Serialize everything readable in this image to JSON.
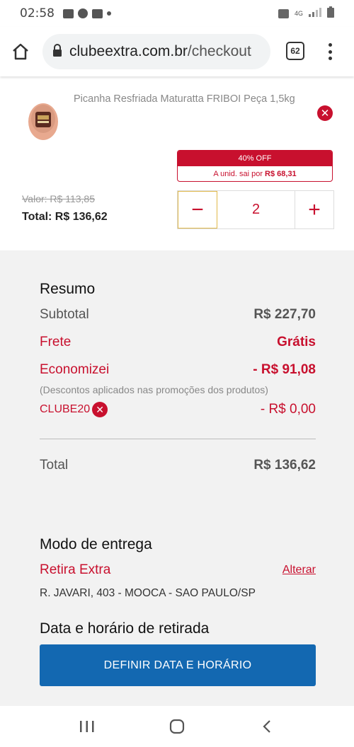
{
  "status_bar": {
    "time": "02:58",
    "signal": "4G"
  },
  "browser": {
    "url_domain": "clubeextra.com.br",
    "url_path": "/checkout",
    "tab_count": "62"
  },
  "product": {
    "name": "Picanha Resfriada Maturatta FRIBOI Peça 1,5kg",
    "promo_off": "40% OFF",
    "promo_unit_label": "A unid. sai por",
    "promo_unit_price": "R$ 68,31",
    "old_price": "Valor: R$ 113,85",
    "total": "Total: R$ 136,62",
    "quantity": "2",
    "minus_symbol": "−",
    "plus_symbol": "+"
  },
  "summary": {
    "title": "Resumo",
    "subtotal_label": "Subtotal",
    "subtotal_value": "R$ 227,70",
    "shipping_label": "Frete",
    "shipping_value": "Grátis",
    "savings_label": "Economizei",
    "savings_value": "- R$ 91,08",
    "savings_note": "(Descontos aplicados nas promoções dos produtos)",
    "coupon_code": "CLUBE20",
    "coupon_value": "- R$ 0,00",
    "total_label": "Total",
    "total_value": "R$ 136,62"
  },
  "delivery": {
    "title": "Modo de entrega",
    "mode": "Retira Extra",
    "change_label": "Alterar",
    "address": "R. JAVARI, 403 - MOOCA - SAO PAULO/SP"
  },
  "pickup": {
    "title": "Data e horário de retirada",
    "button_label": "DEFINIR DATA E HORÁRIO"
  },
  "colors": {
    "accent_red": "#c8102e",
    "cta_blue": "#1368b1",
    "summary_bg": "#f2f2f2"
  }
}
